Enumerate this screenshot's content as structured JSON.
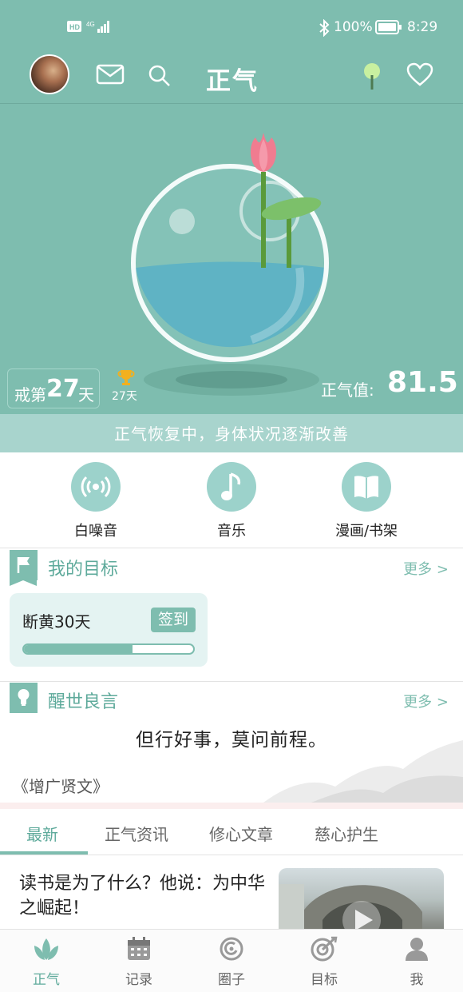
{
  "status": {
    "network": "HD 4G",
    "battery": "100%",
    "time": "8:29"
  },
  "header": {
    "title": "正气"
  },
  "hero": {
    "streak_prefix": "戒第",
    "streak_days": "27",
    "streak_suffix": "天",
    "best_days": "27天",
    "value_label": "正气值:",
    "value": "81.5",
    "status_text": "正气恢复中，身体状况逐渐改善"
  },
  "quick_actions": [
    {
      "label": "白噪音",
      "icon": "broadcast-icon"
    },
    {
      "label": "音乐",
      "icon": "music-note-icon"
    },
    {
      "label": "漫画/书架",
      "icon": "book-icon"
    }
  ],
  "goals": {
    "title": "我的目标",
    "more": "更多 >",
    "card": {
      "name": "断黄30天",
      "checkin": "签到",
      "progress": 0.64
    }
  },
  "quotes": {
    "title": "醒世良言",
    "more": "更多 >",
    "text": "但行好事，莫问前程。",
    "source": "《增广贤文》"
  },
  "tabs": [
    "最新",
    "正气资讯",
    "修心文章",
    "慈心护生"
  ],
  "active_tab": 0,
  "article": {
    "title": "读书是为了什么？他说：为中华之崛起！"
  },
  "bottom_nav": [
    {
      "label": "正气",
      "icon": "lotus-icon"
    },
    {
      "label": "记录",
      "icon": "calendar-icon"
    },
    {
      "label": "圈子",
      "icon": "circle-icon"
    },
    {
      "label": "目标",
      "icon": "target-icon"
    },
    {
      "label": "我",
      "icon": "person-icon"
    }
  ],
  "colors": {
    "primary": "#7ebdaf",
    "accent_text": "#5eaa9b",
    "banner": "#a8d4cd",
    "lotus": "#f07c90",
    "leaf": "#7cc06a"
  }
}
